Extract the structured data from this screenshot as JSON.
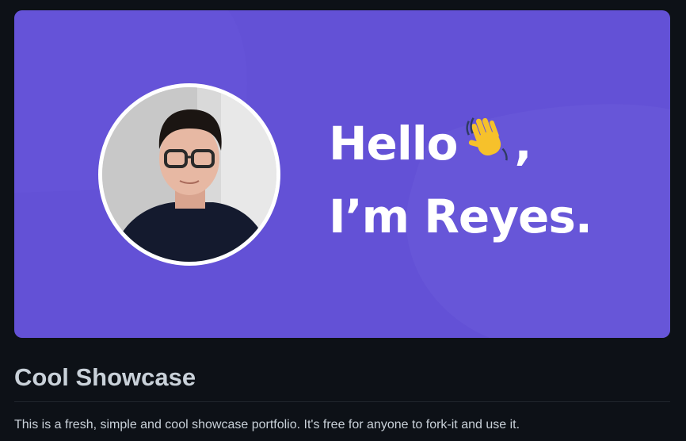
{
  "banner": {
    "background_color": "#6351d6",
    "greeting_line1": "Hello",
    "greeting_comma": ",",
    "greeting_line2": "I’m Reyes.",
    "wave_icon": "waving-hand-icon",
    "avatar_alt": "profile photo"
  },
  "readme": {
    "title": "Cool Showcase",
    "description": "This is a fresh, simple and cool showcase portfolio. It's free for anyone to fork-it and use it."
  },
  "colors": {
    "page_background": "#0d1117",
    "text": "#c9d1d9",
    "divider": "#21262d"
  }
}
